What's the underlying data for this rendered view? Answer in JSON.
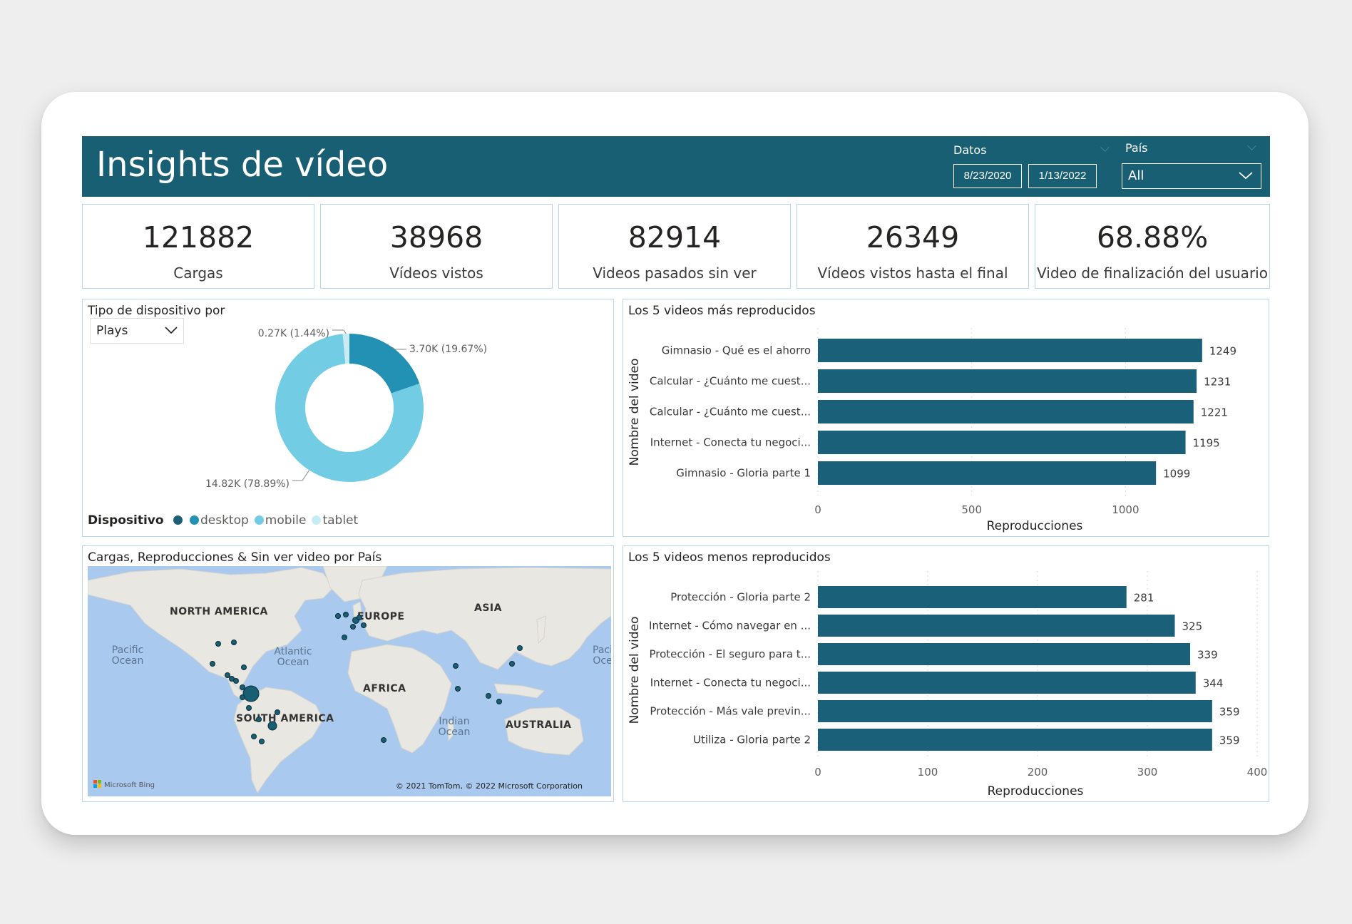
{
  "header": {
    "title": "Insights de vídeo",
    "date_slicer": {
      "label": "Datos",
      "start": "8/23/2020",
      "end": "1/13/2022"
    },
    "country_slicer": {
      "label": "País",
      "selected": "All"
    }
  },
  "kpis": [
    {
      "value": "121882",
      "label": "Cargas"
    },
    {
      "value": "38968",
      "label": "Vídeos vistos"
    },
    {
      "value": "82914",
      "label": "Videos pasados sin ver"
    },
    {
      "value": "26349",
      "label": "Vídeos vistos hasta el final"
    },
    {
      "value": "68.88%",
      "label": "Video de finalización del usuario"
    }
  ],
  "donut_panel": {
    "title": "Tipo de dispositivo por",
    "measure": "Plays",
    "legend_title": "Dispositivo"
  },
  "map_panel": {
    "title": "Cargas, Reproducciones & Sin ver video por País",
    "labels": {
      "north_america": "NORTH AMERICA",
      "europe": "EUROPE",
      "asia": "ASIA",
      "africa": "AFRICA",
      "south_america": "SOUTH AMERICA",
      "australia": "AUSTRALIA",
      "pacific_1": "Pacific",
      "pacific_2": "Ocean",
      "atlantic_1": "Atlantic",
      "atlantic_2": "Ocean",
      "indian_1": "Indian",
      "indian_2": "Ocean",
      "pacific_right_1": "Paci",
      "pacific_right_2": "Oce"
    },
    "attribution": "© 2021 TomTom, © 2022 Microsoft Corporation",
    "logo_text": "Microsoft Bing"
  },
  "colors": {
    "header_bg": "#185f74",
    "bar": "#1a6078",
    "desktop": "#1c5f77",
    "mobile_dark": "#2291b4",
    "mobile": "#72cde4",
    "tablet": "#c8ecf5",
    "panel_border": "#b7d7ea"
  },
  "chart_data": [
    {
      "type": "pie",
      "variant": "donut",
      "measure": "Plays",
      "legend_title": "Dispositivo",
      "legend": [
        {
          "name": "",
          "color": "#1c5f77"
        },
        {
          "name": "desktop",
          "color": "#2291b4"
        },
        {
          "name": "mobile",
          "color": "#72cde4"
        },
        {
          "name": "tablet",
          "color": "#c8ecf5"
        }
      ],
      "slices": [
        {
          "value": 3700,
          "percent": 19.67,
          "label": "3.70K (19.67%)",
          "color": "#2291b4"
        },
        {
          "value": 14820,
          "percent": 78.89,
          "label": "14.82K (78.89%)",
          "color": "#72cde4"
        },
        {
          "value": 270,
          "percent": 1.44,
          "label": "0.27K (1.44%)",
          "color": "#c8ecf5"
        }
      ]
    },
    {
      "type": "bar",
      "orientation": "horizontal",
      "title": "Los 5 videos más reproducidos",
      "categories": [
        "Gimnasio - Qué es el ahorro",
        "Calcular - ¿Cuánto me cuest...",
        "Calcular - ¿Cuánto me cuest...",
        "Internet - Conecta tu negoci...",
        "Gimnasio - Gloria parte 1"
      ],
      "values": [
        1249,
        1231,
        1221,
        1195,
        1099
      ],
      "xlabel": "Reproducciones",
      "ylabel": "Nombre del video",
      "xlim": [
        0,
        1400
      ],
      "xticks": [
        0,
        500,
        1000
      ],
      "grid": true
    },
    {
      "type": "bar",
      "orientation": "horizontal",
      "title": "Los 5 videos menos reproducidos",
      "categories": [
        "Protección - Gloria parte 2",
        "Internet - Cómo navegar en ...",
        "Protección - El seguro para t...",
        "Internet - Conecta tu negoci...",
        "Protección - Más vale previn...",
        "Utiliza - Gloria parte 2"
      ],
      "values": [
        281,
        325,
        339,
        344,
        359,
        359
      ],
      "xlabel": "Reproducciones",
      "ylabel": "Nombre del video",
      "xlim": [
        0,
        400
      ],
      "xticks": [
        0,
        100,
        200,
        300,
        400
      ],
      "grid": true
    }
  ]
}
